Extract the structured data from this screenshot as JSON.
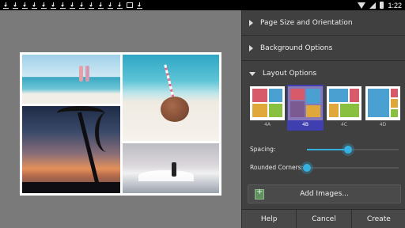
{
  "statusbar": {
    "time": "1:22",
    "left_icons": [
      "download-icon",
      "download-icon",
      "download-icon",
      "download-icon",
      "download-icon",
      "download-icon",
      "download-icon",
      "download-icon",
      "download-icon",
      "download-icon",
      "download-icon",
      "download-icon",
      "download-icon",
      "image-icon",
      "download-icon"
    ],
    "right_icons": [
      "wifi-icon",
      "signal-icon",
      "battery-icon"
    ]
  },
  "canvas": {
    "photos": [
      "beach-couple-photo",
      "coconut-drink-photo",
      "palm-sunset-photo",
      "surfer-photo"
    ]
  },
  "panel": {
    "sections": [
      {
        "label": "Page Size and Orientation",
        "expanded": false
      },
      {
        "label": "Background Options",
        "expanded": false
      },
      {
        "label": "Layout Options",
        "expanded": true
      }
    ],
    "layouts": [
      {
        "label": "4A",
        "selected": false
      },
      {
        "label": "4B",
        "selected": true
      },
      {
        "label": "4C",
        "selected": false
      },
      {
        "label": "4D",
        "selected": false
      }
    ],
    "spacing": {
      "label": "Spacing:",
      "value": 0.45
    },
    "rounded_corners": {
      "label": "Rounded Corners:",
      "value": 0.0
    },
    "add_images_label": "Add Images...",
    "buttons": {
      "help": "Help",
      "cancel": "Cancel",
      "create": "Create"
    },
    "accent_color": "#35b0e0",
    "selection_color": "#3f3fb0"
  }
}
